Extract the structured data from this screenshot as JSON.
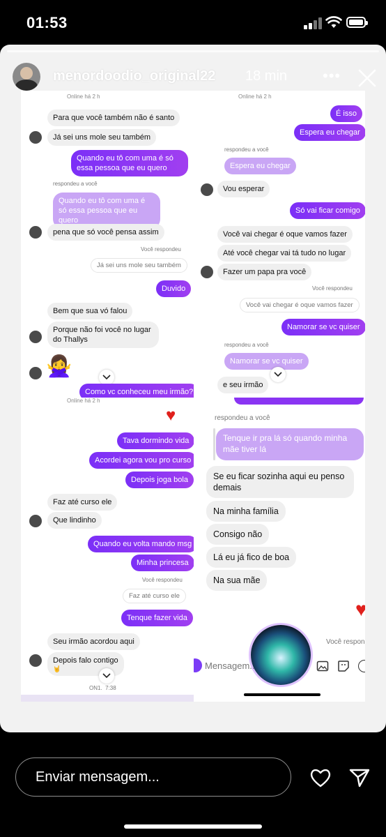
{
  "status_bar": {
    "time": "01:53"
  },
  "story": {
    "username": "menordoodio_original22",
    "time_ago": "18 min"
  },
  "shot1": {
    "header_status": "Online há 2 h",
    "msgs": [
      "Para que você também não é santo",
      "Já sei uns mole seu também",
      "Quando eu tô com uma é só essa pessoa que eu quero",
      "respondeu a você",
      "Quando eu tô com uma é só essa pessoa que eu quero",
      "pena que só você pensa assim",
      "Você respondeu",
      "Já sei uns mole seu também",
      "Duvido",
      "Bem que sua vó falou",
      "Porque não foi você no lugar do Thallys",
      "🙅‍♀️",
      "Como vc conheceu meu irmão?"
    ]
  },
  "shot2": {
    "header_status": "Online há 2 h",
    "msgs": [
      "É isso",
      "Espera eu chegar",
      "respondeu a você",
      "Espera eu chegar",
      "Vou esperar",
      "Só vai ficar comigo",
      "Você vai chegar é oque vamos fazer",
      "Até você chegar vai tá tudo no lugar",
      "Fazer um papa pra você",
      "Você respondeu",
      "Você vai chegar é oque vamos fazer",
      "Namorar se vc quiser",
      "respondeu a você",
      "Namorar se vc quiser",
      "e seu irmão"
    ]
  },
  "shot3": {
    "header_status": "Online há 2 h",
    "msgs": [
      "Tava dormindo vida",
      "Acordei agora vou pro curso",
      "Depois joga bola",
      "Faz até curso ele",
      "Que lindinho",
      "Quando eu volta mando msg",
      "Minha princesa",
      "Você respondeu",
      "Faz até curso ele",
      "Tenque fazer vida",
      "Seu irmão acordou aqui",
      "Depois falo contigo",
      "🤘",
      "ON1",
      "7:38"
    ]
  },
  "shot4": {
    "msgs": [
      "respondeu a você",
      "Tenque ir pra lá só quando minha mãe tiver lá",
      "Se eu ficar sozinha aqui eu penso demais",
      "Na minha família",
      "Consigo não",
      "Lá eu já fico de boa",
      "Na sua mãe",
      "Você respon"
    ],
    "input_placeholder": "Mensagem..."
  },
  "footer": {
    "reply_placeholder": "Enviar mensagem..."
  },
  "icons": {
    "heart": "heart-icon",
    "send": "send-icon",
    "more": "more-icon",
    "close": "close-icon"
  },
  "colors": {
    "purple_bubble": "#8a34f3",
    "light_purple": "#c9a6f5",
    "gray_bubble": "#efefef",
    "siri_teal": "#2fb7a8"
  }
}
